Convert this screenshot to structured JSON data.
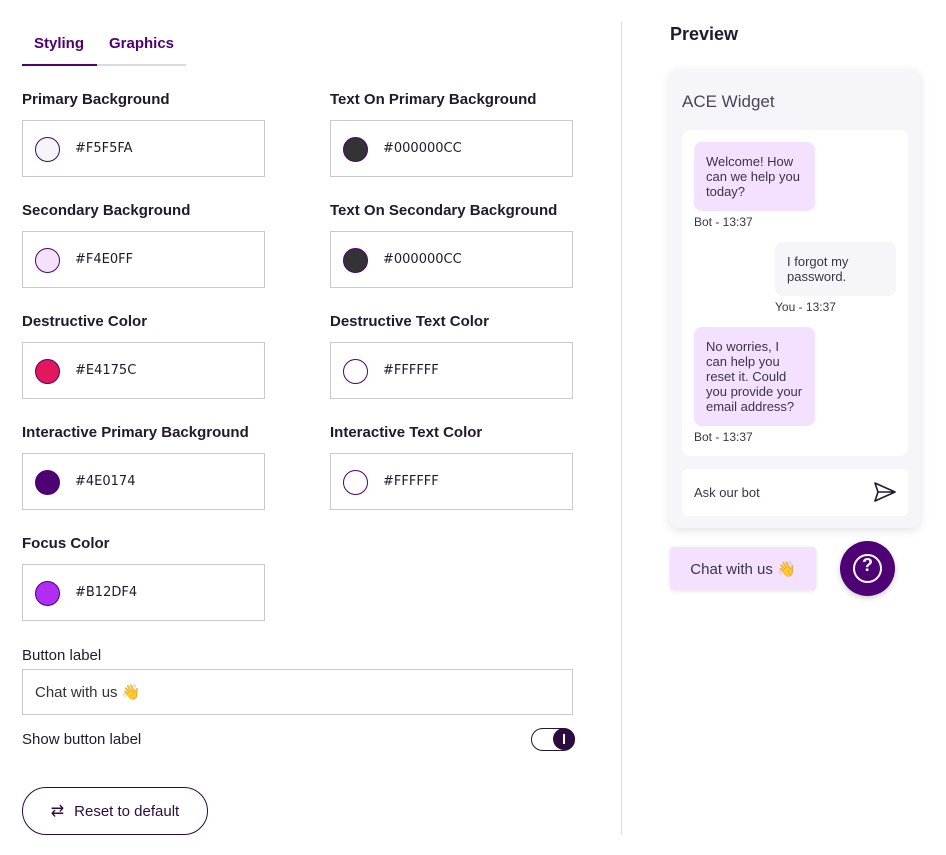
{
  "tabs": {
    "styling": "Styling",
    "graphics": "Graphics"
  },
  "fields": {
    "primary_background": {
      "label": "Primary Background",
      "value": "#F5F5FA",
      "color": "#F5F5FA"
    },
    "text_on_primary_background": {
      "label": "Text On Primary Background",
      "value": "#000000CC",
      "color": "#333333"
    },
    "secondary_background": {
      "label": "Secondary Background",
      "value": "#F4E0FF",
      "color": "#F4E0FF"
    },
    "text_on_secondary_background": {
      "label": "Text On Secondary Background",
      "value": "#000000CC",
      "color": "#333333"
    },
    "destructive_color": {
      "label": "Destructive Color",
      "value": "#E4175C",
      "color": "#E4175C"
    },
    "destructive_text_color": {
      "label": "Destructive Text Color",
      "value": "#FFFFFF",
      "color": "#FFFFFF"
    },
    "interactive_primary_background": {
      "label": "Interactive Primary Background",
      "value": "#4E0174",
      "color": "#4E0174"
    },
    "interactive_text_color": {
      "label": "Interactive Text Color",
      "value": "#FFFFFF",
      "color": "#FFFFFF"
    },
    "focus_color": {
      "label": "Focus Color",
      "value": "#B12DF4",
      "color": "#B12DF4"
    }
  },
  "button_label": {
    "label": "Button label",
    "value": "Chat with us 👋"
  },
  "show_button_label": {
    "label": "Show button label",
    "checked": true
  },
  "reset": {
    "label": "Reset to default"
  },
  "preview": {
    "title": "Preview",
    "widget_title": "ACE Widget",
    "messages": [
      {
        "from": "bot",
        "text": "Welcome! How can we help you today?",
        "meta": "Bot - 13:37"
      },
      {
        "from": "user",
        "text": "I forgot my password.",
        "meta": "You - 13:37"
      },
      {
        "from": "bot",
        "text": "No worries, I can help you reset it. Could you provide your email address?",
        "meta": "Bot - 13:37"
      }
    ],
    "composer_placeholder": "Ask our bot",
    "chat_button": "Chat with us 👋",
    "help_icon": "?"
  },
  "icons": {
    "reset": "swap-arrows-icon",
    "send": "send-icon",
    "help": "question-mark-icon"
  }
}
